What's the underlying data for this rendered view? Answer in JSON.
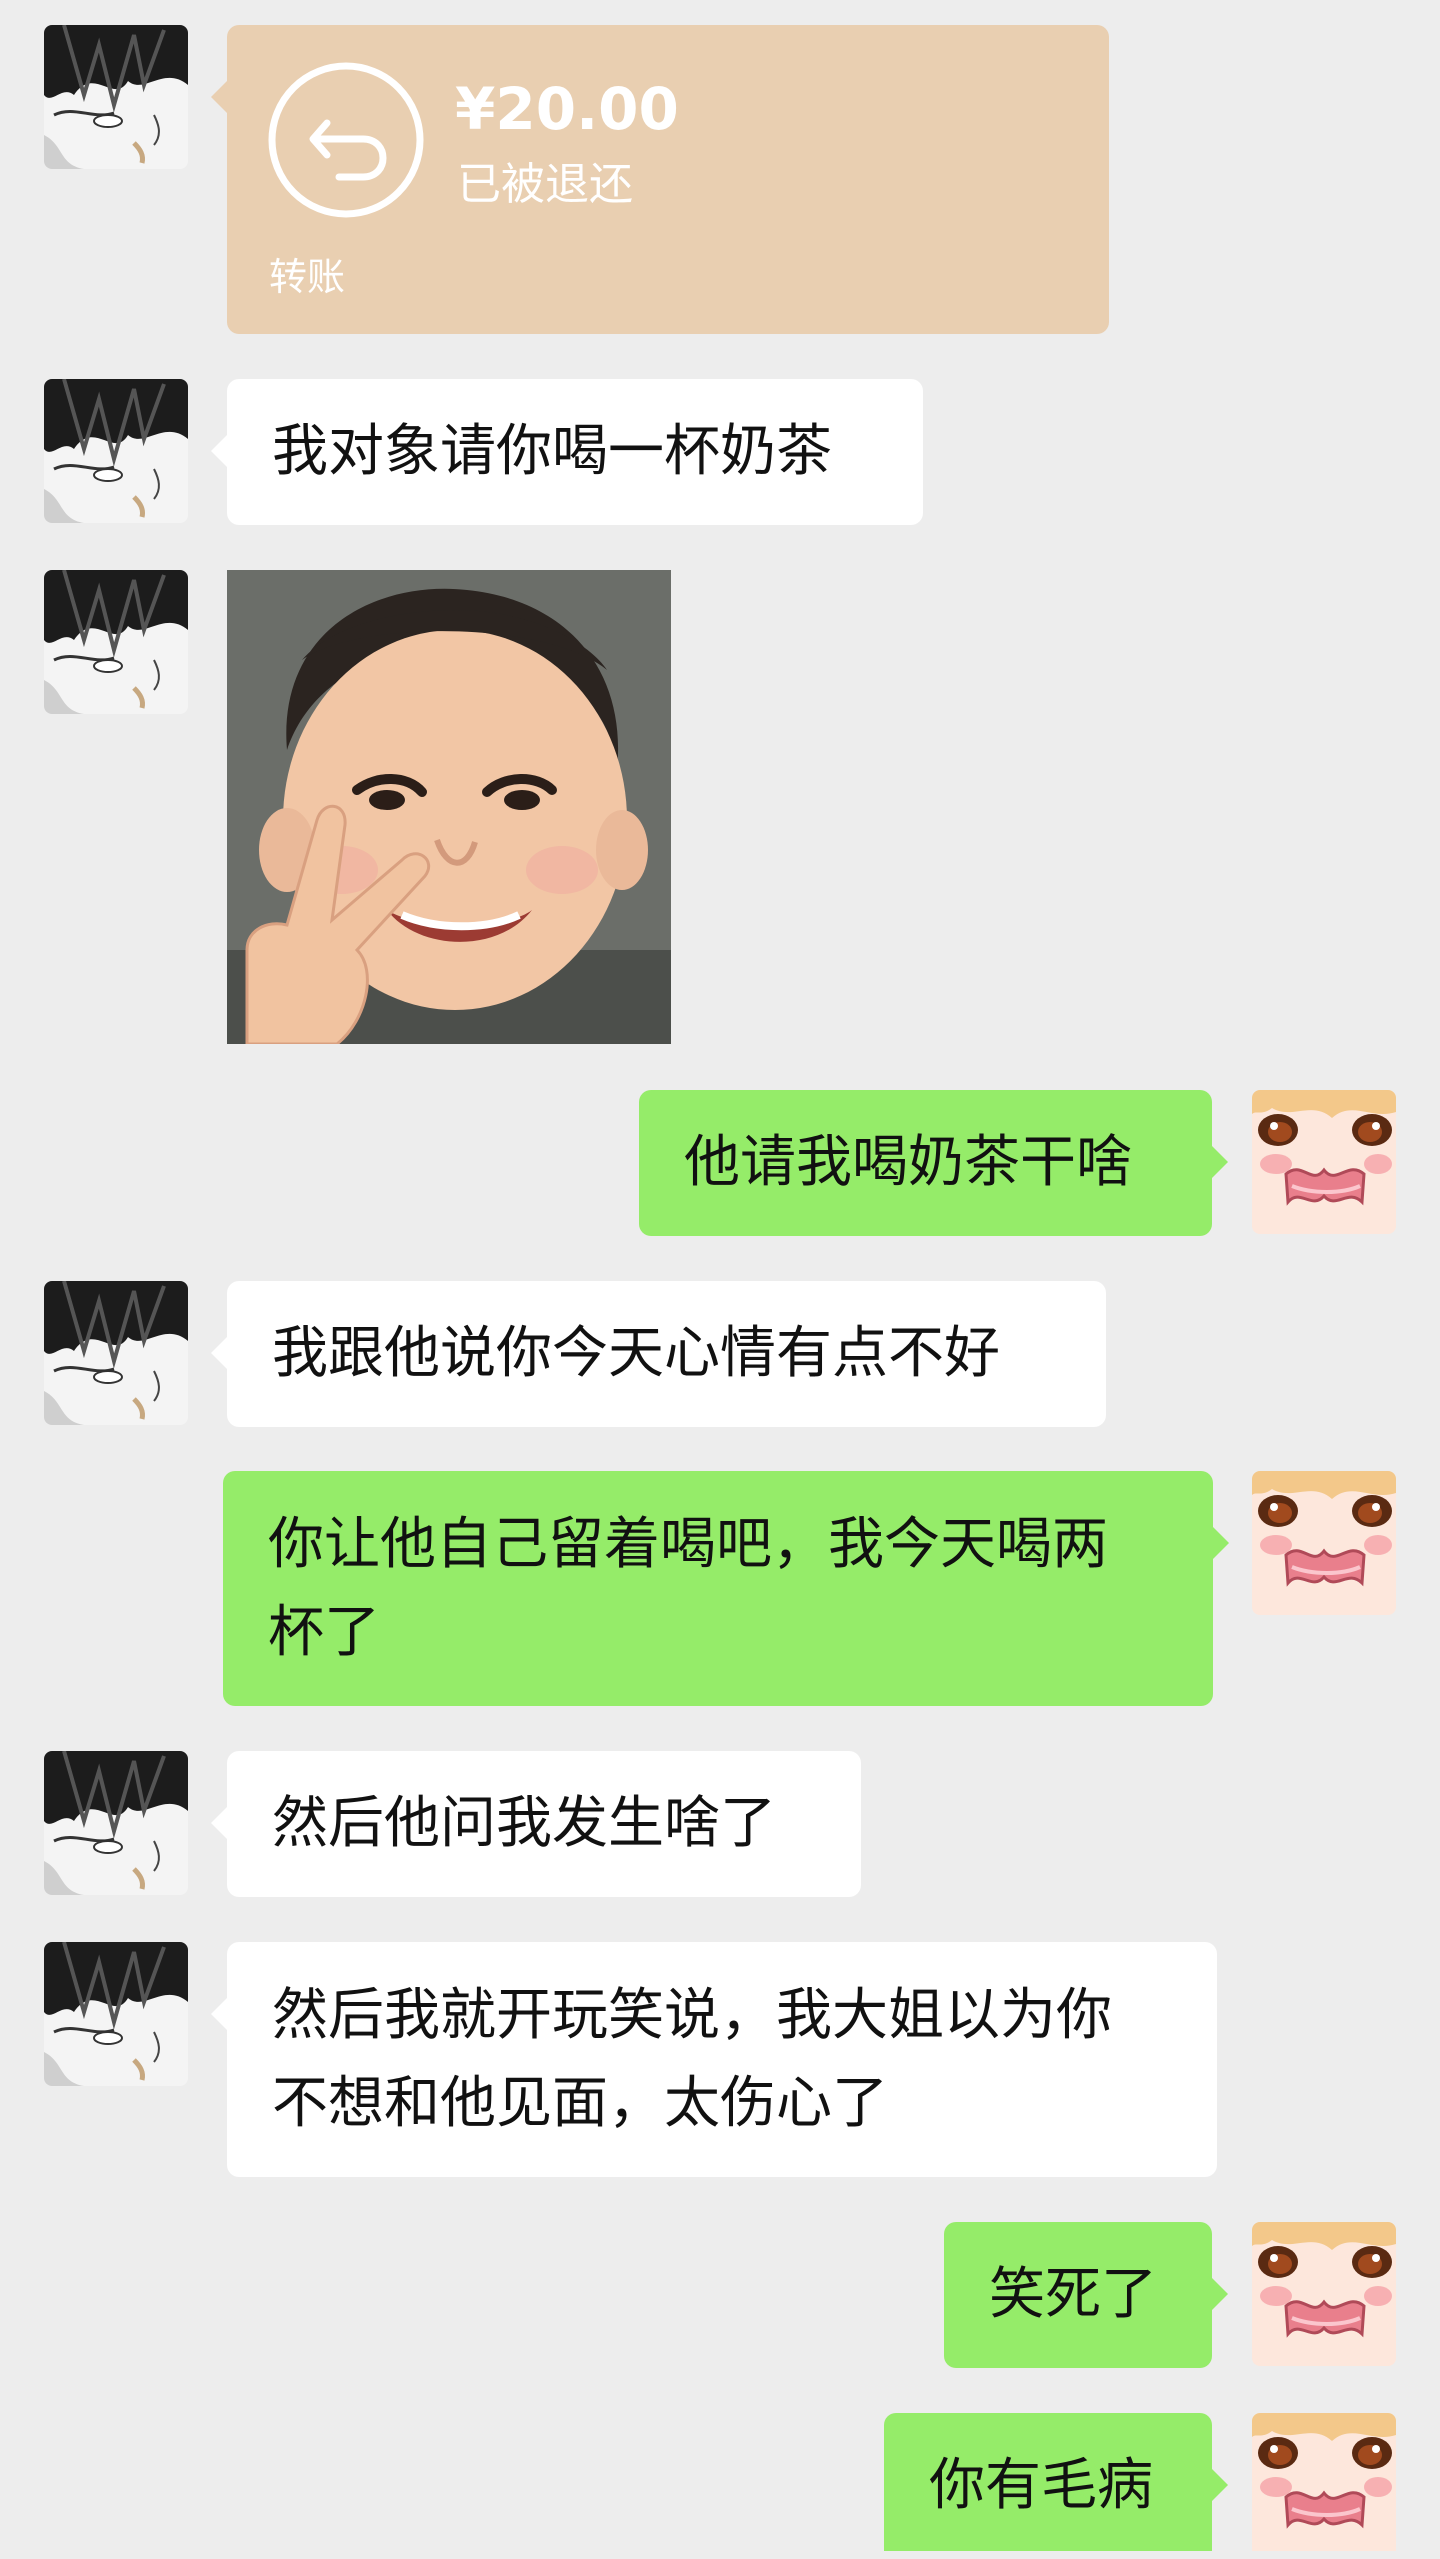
{
  "chat": {
    "transfer": {
      "amount": "¥20.00",
      "status": "已被退还",
      "label": "转账",
      "icon": "return-arrow-icon"
    },
    "messages": [
      {
        "side": "left",
        "text": "我对象请你喝一杯奶茶"
      },
      {
        "side": "left",
        "type": "sticker",
        "description": "smiling-child-peace-sign-sticker"
      },
      {
        "side": "right",
        "text": "他请我喝奶茶干啥"
      },
      {
        "side": "left",
        "text": "我跟他说你今天心情有点不好"
      },
      {
        "side": "right",
        "lines": [
          "你让他自己留着喝吧，我今天喝两",
          "杯了"
        ]
      },
      {
        "side": "left",
        "text": "然后他问我发生啥了"
      },
      {
        "side": "left",
        "lines": [
          "然后我就开玩笑说，我大姐以为你",
          "不想和他见面，太伤心了"
        ]
      },
      {
        "side": "right",
        "text": "笑死了"
      },
      {
        "side": "right",
        "text": "你有毛病"
      }
    ]
  },
  "colors": {
    "background": "#ededed",
    "incoming_bubble": "#ffffff",
    "outgoing_bubble": "#95ec69",
    "transfer_card": "#e9cfb1"
  }
}
